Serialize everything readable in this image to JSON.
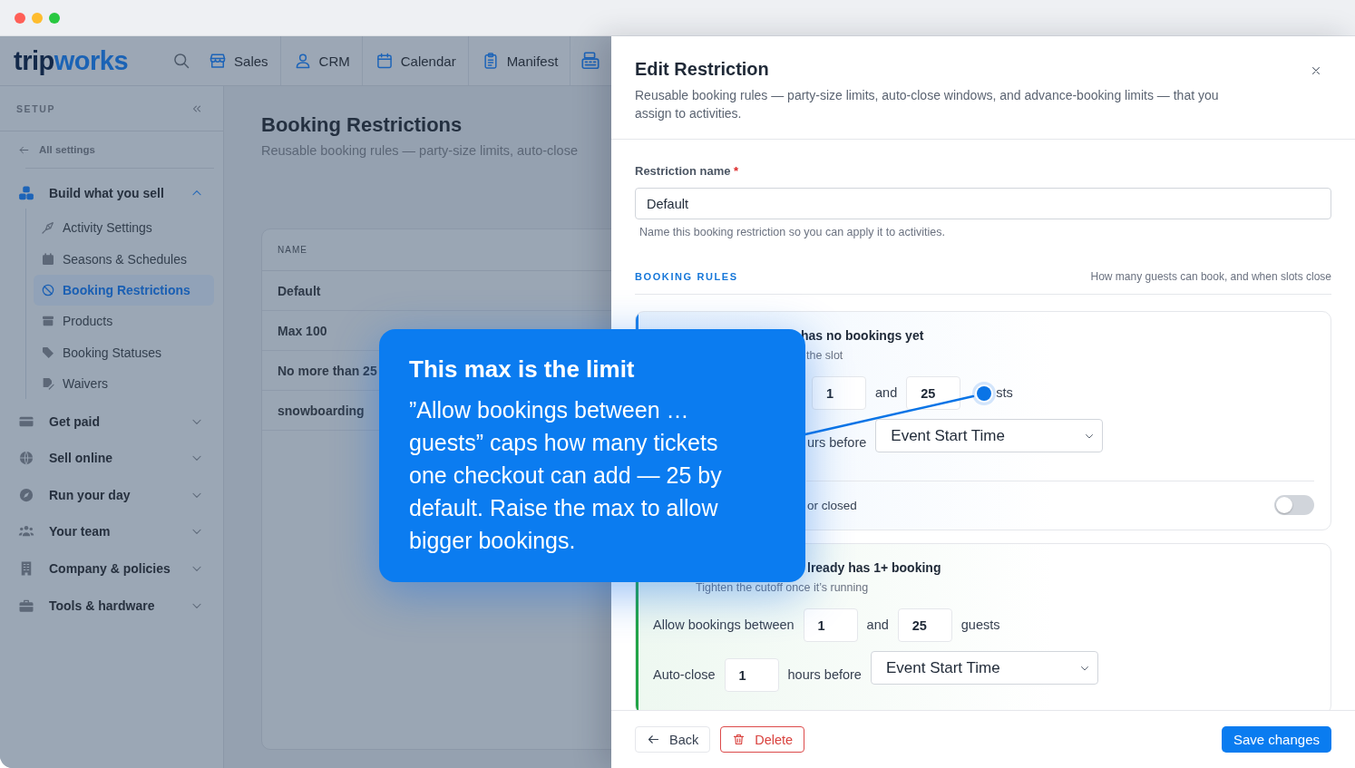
{
  "window": {
    "controls": [
      {
        "color": "#ff5f57"
      },
      {
        "color": "#febc2e"
      },
      {
        "color": "#28c840"
      }
    ]
  },
  "top_nav": {
    "logo": [
      "trip",
      "works"
    ],
    "items": [
      {
        "label": "Sales"
      },
      {
        "label": "CRM"
      },
      {
        "label": "Calendar"
      },
      {
        "label": "Manifest"
      }
    ]
  },
  "sidebar": {
    "heading": "SETUP",
    "back_link": "All settings",
    "groups": [
      {
        "label": "Build what you sell",
        "expanded": true,
        "children": [
          {
            "label": "Activity Settings",
            "selected": false
          },
          {
            "label": "Seasons & Schedules",
            "selected": false
          },
          {
            "label": "Booking Restrictions",
            "selected": true
          },
          {
            "label": "Products",
            "selected": false
          },
          {
            "label": "Booking Statuses",
            "selected": false
          },
          {
            "label": "Waivers",
            "selected": false
          }
        ]
      },
      {
        "label": "Get paid",
        "expanded": false
      },
      {
        "label": "Sell online",
        "expanded": false
      },
      {
        "label": "Run your day",
        "expanded": false
      },
      {
        "label": "Your team",
        "expanded": false
      },
      {
        "label": "Company & policies",
        "expanded": false
      },
      {
        "label": "Tools & hardware",
        "expanded": false
      }
    ]
  },
  "page": {
    "title": "Booking Restrictions",
    "subtitle": "Reusable booking rules — party-size limits, auto-close",
    "table": {
      "columns": [
        "NAME"
      ],
      "rows": [
        [
          "Default"
        ],
        [
          "Max 100"
        ],
        [
          "No more than 25"
        ],
        [
          "snowboarding"
        ]
      ]
    }
  },
  "callout": {
    "title": "This max is the limit",
    "body": "”Allow bookings between … guests” caps how many tickets one checkout can add — 25 by default. Raise the max to allow bigger bookings."
  },
  "drawer": {
    "title": "Edit Restriction",
    "description": "Reusable booking rules — party-size limits, auto-close windows, and advance-booking limits — that you assign to activities.",
    "name_field": {
      "label": "Restriction name",
      "required_mark": "*",
      "value": "Default",
      "hint": "Name this booking restriction so you can apply it to activities."
    },
    "section": {
      "title": "BOOKING RULES",
      "note": "How many guests can book, and when slots close"
    },
    "rules": [
      {
        "color": "#1a7fe8",
        "title": "has no bookings yet",
        "subtitle": "the slot",
        "party_size": {
          "min": "1",
          "joiner": "and",
          "max": "25",
          "hotspot": true,
          "unit": "sts"
        },
        "auto_close": {
          "unit": "urs before",
          "anchor": "Event Start Time"
        },
        "toggle": {
          "label": "or closed",
          "on": false
        }
      },
      {
        "color": "#22a447",
        "title": "lready has 1+ booking",
        "subtitle": "Tighten the cutoff once it’s running",
        "party_size": {
          "label": "Allow bookings between",
          "min": "1",
          "joiner": "and",
          "max": "25",
          "hotspot": false,
          "unit": "guests"
        },
        "auto_close": {
          "label": "Auto-close",
          "hours": "1",
          "unit": "hours before",
          "anchor": "Event Start Time"
        }
      }
    ],
    "footer": {
      "back": "Back",
      "delete": "Delete",
      "save": "Save changes"
    }
  }
}
